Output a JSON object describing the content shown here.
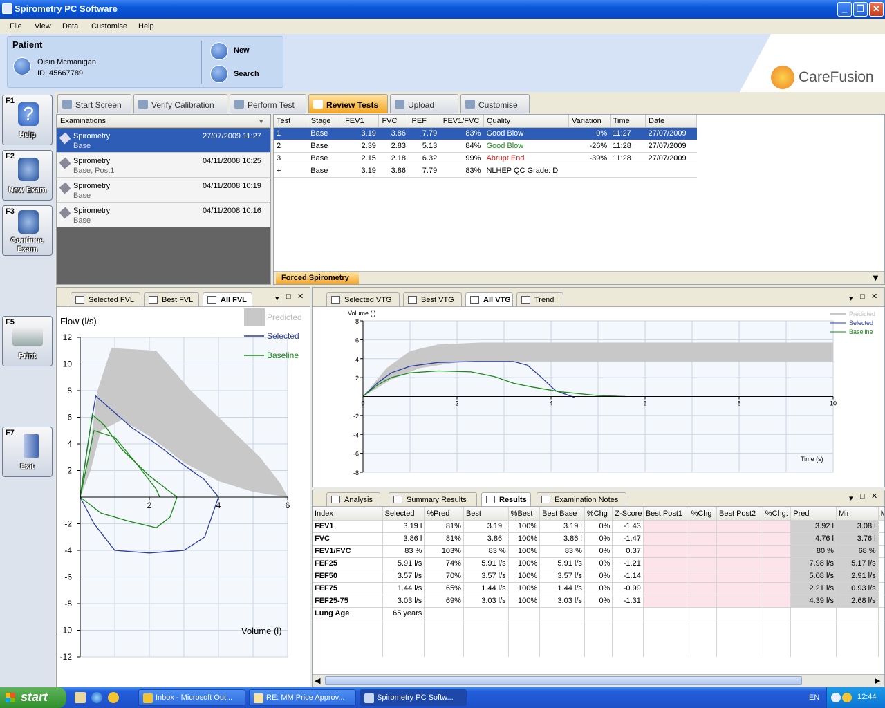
{
  "window": {
    "title": "Spirometry PC Software",
    "controls": [
      "_",
      "❐",
      "✕"
    ]
  },
  "menu": [
    "File",
    "View",
    "Data",
    "Customise",
    "Help"
  ],
  "patient": {
    "heading": "Patient",
    "name": "Oisin Mcmanigan",
    "id": "ID: 45667789",
    "new_label": "New",
    "search_label": "Search"
  },
  "brand": "CareFusion",
  "side_keys": [
    {
      "key": "F1",
      "label": "Help"
    },
    {
      "key": "F2",
      "label": "New Exam"
    },
    {
      "key": "F3",
      "label_line1": "Continue",
      "label_line2": "Exam"
    },
    {
      "key": "F5",
      "label": "Print"
    },
    {
      "key": "F7",
      "label": "Exit"
    }
  ],
  "tabs": [
    "Start Screen",
    "Verify Calibration",
    "Perform Test",
    "Review Tests",
    "Upload",
    "Customise"
  ],
  "examinations": {
    "header": "Examinations",
    "items": [
      {
        "name": "Spirometry",
        "sub": "Base",
        "date": "27/07/2009 11:27"
      },
      {
        "name": "Spirometry",
        "sub": "Base, Post1",
        "date": "04/11/2008 10:25"
      },
      {
        "name": "Spirometry",
        "sub": "Base",
        "date": "04/11/2008 10:19"
      },
      {
        "name": "Spirometry",
        "sub": "Base",
        "date": "04/11/2008 10:16"
      }
    ]
  },
  "tests": {
    "columns": [
      "Test",
      "Stage",
      "FEV1",
      "FVC",
      "PEF",
      "FEV1/FVC",
      "Quality",
      "Variation",
      "Time",
      "Date"
    ],
    "rows": [
      [
        "1",
        "Base",
        "3.19",
        "3.86",
        "7.79",
        "83%",
        "Good Blow",
        "0%",
        "11:27",
        "27/07/2009"
      ],
      [
        "2",
        "Base",
        "2.39",
        "2.83",
        "5.13",
        "84%",
        "Good Blow",
        "-26%",
        "11:28",
        "27/07/2009"
      ],
      [
        "3",
        "Base",
        "2.15",
        "2.18",
        "6.32",
        "99%",
        "Abrupt End",
        "-39%",
        "11:28",
        "27/07/2009"
      ],
      [
        "+",
        "Base",
        "3.19",
        "3.86",
        "7.79",
        "83%",
        "NLHEP QC Grade: D",
        "",
        "",
        ""
      ]
    ],
    "quality_colors": {
      "Good Blow": "#1a8a1a",
      "Abrupt End": "#d42020"
    },
    "footer_tab": "Forced Spirometry"
  },
  "fvl": {
    "tabs": [
      "Selected FVL",
      "Best FVL",
      "All FVL"
    ],
    "ylabel": "Flow (l/s)",
    "xlabel": "Volume (l)",
    "legend": [
      "Predicted",
      "Selected",
      "Baseline"
    ],
    "yticks": [
      "12",
      "10",
      "8",
      "6",
      "4",
      "2",
      "-2",
      "-4",
      "-6",
      "-8",
      "-10",
      "-12"
    ],
    "xticks": [
      "2",
      "4",
      "6"
    ]
  },
  "vtg": {
    "tabs": [
      "Selected VTG",
      "Best VTG",
      "All VTG",
      "Trend"
    ],
    "ylabel": "Volume (l)",
    "xlabel": "Time (s)",
    "legend": [
      "Predicted",
      "Selected",
      "Baseline"
    ],
    "yticks": [
      "8",
      "6",
      "4",
      "2",
      "-2",
      "-4",
      "-6",
      "-8"
    ],
    "xticks": [
      "0",
      "2",
      "4",
      "6",
      "8",
      "10"
    ]
  },
  "chart_data": [
    {
      "type": "line",
      "title": "",
      "xlabel": "Volume (l)",
      "ylabel": "Flow (l/s)",
      "xlim": [
        0,
        6
      ],
      "ylim": [
        -12,
        12
      ],
      "grid": true,
      "legend": "top-right",
      "series": [
        {
          "name": "Predicted",
          "color": "#c8c8c8",
          "upper": [
            [
              0.3,
              4
            ],
            [
              0.5,
              8
            ],
            [
              0.9,
              11.2
            ],
            [
              2.2,
              11
            ],
            [
              3.2,
              8
            ],
            [
              4.2,
              5.5
            ],
            [
              5.2,
              3
            ],
            [
              5.8,
              1
            ],
            [
              6,
              0
            ]
          ],
          "lower": [
            [
              0,
              0
            ],
            [
              0.3,
              2
            ],
            [
              0.6,
              5
            ],
            [
              1.2,
              5.8
            ],
            [
              2,
              4.6
            ],
            [
              3,
              2.6
            ],
            [
              4,
              1.2
            ],
            [
              5,
              0.4
            ],
            [
              6,
              0
            ]
          ]
        },
        {
          "name": "Selected",
          "color": "#2b3ea3",
          "points": [
            [
              0,
              0
            ],
            [
              0.25,
              4.5
            ],
            [
              0.45,
              7.6
            ],
            [
              0.8,
              6.8
            ],
            [
              1.5,
              5.2
            ],
            [
              2.2,
              4
            ],
            [
              3,
              2.4
            ],
            [
              3.6,
              1.3
            ],
            [
              4,
              0
            ],
            [
              3.6,
              -3
            ],
            [
              3,
              -4
            ],
            [
              2,
              -4.2
            ],
            [
              1,
              -4
            ],
            [
              0.4,
              -2
            ],
            [
              0,
              0
            ]
          ]
        },
        {
          "name": "Baseline",
          "color": "#1a8a1a",
          "points": [
            [
              0,
              0
            ],
            [
              0.35,
              6.2
            ],
            [
              0.7,
              5.4
            ],
            [
              1.2,
              3.6
            ],
            [
              2,
              1.6
            ],
            [
              2.8,
              0
            ],
            [
              2.6,
              -1.5
            ],
            [
              2.2,
              -2.3
            ],
            [
              1.4,
              -1.8
            ],
            [
              0.6,
              -1.2
            ],
            [
              0,
              0
            ],
            [
              0.4,
              5
            ],
            [
              1,
              4.5
            ],
            [
              1.6,
              2.6
            ],
            [
              2.2,
              0.6
            ],
            [
              2.3,
              0
            ]
          ]
        }
      ]
    },
    {
      "type": "line",
      "title": "",
      "xlabel": "Time (s)",
      "ylabel": "Volume (l)",
      "xlim": [
        0,
        10
      ],
      "ylim": [
        -8,
        8
      ],
      "grid": true,
      "legend": "top-right",
      "series": [
        {
          "name": "Predicted",
          "color": "#c8c8c8",
          "upper": [
            [
              0,
              0
            ],
            [
              0.5,
              3
            ],
            [
              1,
              4.8
            ],
            [
              1.6,
              5.5
            ],
            [
              2.5,
              5.7
            ],
            [
              10,
              5.7
            ]
          ],
          "lower": [
            [
              0,
              0
            ],
            [
              0.6,
              1.8
            ],
            [
              1.2,
              3
            ],
            [
              2,
              3.6
            ],
            [
              3,
              3.7
            ],
            [
              10,
              3.7
            ]
          ]
        },
        {
          "name": "Selected",
          "color": "#2b3ea3",
          "points": [
            [
              0,
              0
            ],
            [
              0.3,
              1.4
            ],
            [
              0.6,
              2.5
            ],
            [
              1,
              3.2
            ],
            [
              1.6,
              3.6
            ],
            [
              2.4,
              3.7
            ],
            [
              3.2,
              3.7
            ],
            [
              3.5,
              3.3
            ],
            [
              3.8,
              2
            ],
            [
              4.1,
              0.6
            ],
            [
              4.5,
              -0.1
            ]
          ]
        },
        {
          "name": "Baseline",
          "color": "#1a8a1a",
          "points": [
            [
              0,
              0
            ],
            [
              0.3,
              1.2
            ],
            [
              0.6,
              2
            ],
            [
              1,
              2.5
            ],
            [
              1.6,
              2.7
            ],
            [
              2.3,
              2.6
            ],
            [
              2.8,
              2.1
            ],
            [
              3.2,
              1.4
            ],
            [
              3.6,
              1
            ],
            [
              4.2,
              0.5
            ],
            [
              5,
              0.1
            ],
            [
              5.6,
              0
            ]
          ]
        }
      ]
    }
  ],
  "results": {
    "tabs": [
      "Analysis",
      "Summary Results",
      "Results",
      "Examination Notes"
    ],
    "columns": [
      "Index",
      "Selected",
      "%Pred",
      "Best",
      "%Best",
      "Best Base",
      "%Chg",
      "Z-Score",
      "Best Post1",
      "%Chg",
      "Best Post2",
      "%Chg:",
      "Pred",
      "Min",
      "M"
    ],
    "rows": [
      [
        "FEV1",
        "3.19 l",
        "81%",
        "3.19 l",
        "100%",
        "3.19 l",
        "0%",
        "-1.43",
        "",
        "",
        "",
        "",
        "3.92 l",
        "3.08 l",
        ""
      ],
      [
        "FVC",
        "3.86 l",
        "81%",
        "3.86 l",
        "100%",
        "3.86 l",
        "0%",
        "-1.47",
        "",
        "",
        "",
        "",
        "4.76 l",
        "3.76 l",
        ""
      ],
      [
        "FEV1/FVC",
        "83 %",
        "103%",
        "83 %",
        "100%",
        "83 %",
        "0%",
        "0.37",
        "",
        "",
        "",
        "",
        "80 %",
        "68 %",
        ""
      ],
      [
        "FEF25",
        "5.91 l/s",
        "74%",
        "5.91 l/s",
        "100%",
        "5.91 l/s",
        "0%",
        "-1.21",
        "",
        "",
        "",
        "",
        "7.98 l/s",
        "5.17 l/s",
        ""
      ],
      [
        "FEF50",
        "3.57 l/s",
        "70%",
        "3.57 l/s",
        "100%",
        "3.57 l/s",
        "0%",
        "-1.14",
        "",
        "",
        "",
        "",
        "5.08 l/s",
        "2.91 l/s",
        ""
      ],
      [
        "FEF75",
        "1.44 l/s",
        "65%",
        "1.44 l/s",
        "100%",
        "1.44 l/s",
        "0%",
        "-0.99",
        "",
        "",
        "",
        "",
        "2.21 l/s",
        "0.93 l/s",
        ""
      ],
      [
        "FEF25-75",
        "3.03 l/s",
        "69%",
        "3.03 l/s",
        "100%",
        "3.03 l/s",
        "0%",
        "-1.31",
        "",
        "",
        "",
        "",
        "4.39 l/s",
        "2.68 l/s",
        ""
      ],
      [
        "Lung Age",
        "65 years",
        "",
        "",
        "",
        "",
        "",
        "",
        "",
        "",
        "",
        "",
        "",
        "",
        ""
      ]
    ]
  },
  "taskbar": {
    "start": "start",
    "items": [
      "Inbox - Microsoft Out...",
      "RE: MM Price Approv...",
      "Spirometry PC Softw..."
    ],
    "lang": "EN",
    "clock": "12:44"
  }
}
